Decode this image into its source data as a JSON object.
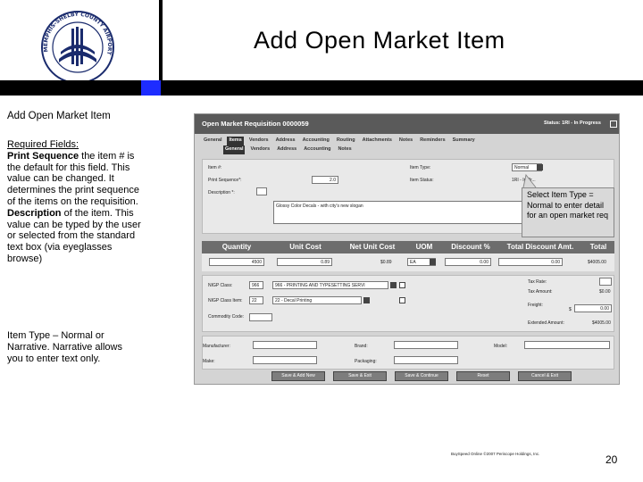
{
  "slide": {
    "title": "Add Open Market Item",
    "subtitle": "Add Open Market Item",
    "page_number": "20",
    "footer": "BuySpeed Online ©2007 Periscope Holdings, Inc."
  },
  "notes": {
    "required_heading": "Required Fields:",
    "print_sequence_term": "Print Sequence",
    "print_sequence_text": " the item # is the default for this field. This value can be changed. It determines the print sequence of the items on the requisition.",
    "description_term": "Description",
    "description_text": " of the item. This value can be typed by the user or selected from the standard text box (via eyeglasses browse)",
    "item_type_text": "Item Type – Normal or Narrative. Narrative allows you to enter text only."
  },
  "callout": {
    "text": "Select Item Type = Normal to enter detail for an open market req"
  },
  "app": {
    "title": "Open Market Requisition 0000059",
    "status": "Status: 1RI - In Progress",
    "tabs_main": [
      "General",
      "Items",
      "Vendors",
      "Address",
      "Accounting",
      "Routing",
      "Attachments",
      "Notes",
      "Reminders",
      "Summary"
    ],
    "tabs_sub": [
      "General",
      "Vendors",
      "Address",
      "Accounting",
      "Notes"
    ],
    "fields": {
      "item_no_label": "Item #:",
      "print_seq_label": "Print Sequence*:",
      "print_seq_value": "2.0",
      "description_label": "Description *:",
      "description_value": "Glossy Color Decals - with city's new slogan",
      "item_type_label": "Item Type:",
      "item_type_value": "Normal",
      "item_status_label": "Item Status:",
      "item_status_value": "1RI - In Pr..."
    },
    "grid": {
      "headers": [
        "Quantity",
        "Unit Cost",
        "Net Unit Cost",
        "UOM",
        "Discount %",
        "Total Discount Amt.",
        "Total"
      ],
      "row": {
        "quantity": "4500",
        "unit_cost": "0.89",
        "net_unit_cost": "$0.89",
        "uom": "EA",
        "discount": "0.00",
        "total_discount": "0.00",
        "total": "$4005.00"
      }
    },
    "nigp": {
      "class_label": "NIGP Class:",
      "class_value": "966",
      "class_desc": "966 - PRINTING AND TYPESETTING SERVI",
      "item_label": "NIGP Class Item:",
      "item_value": "22",
      "item_desc": "22 - Decal Printing",
      "commodity_label": "Commodity Code:",
      "tax_rate_label": "Tax Rate:",
      "tax_amount_label": "Tax Amount:",
      "tax_amount_value": "$0.00",
      "freight_label": "Freight:",
      "freight_value": "0.00",
      "freight_symbol": "$",
      "extended_label": "Extended Amount:",
      "extended_value": "$4005.00"
    },
    "extra": {
      "manufacturer_label": "Manufacturer:",
      "brand_label": "Brand:",
      "model_label": "Model:",
      "make_label": "Make:",
      "packaging_label": "Packaging:"
    },
    "buttons": [
      "Save & Add New",
      "Save & Exit",
      "Save & Continue",
      "Reset",
      "Cancel & Exit"
    ]
  },
  "colors": {
    "accent_blue": "#1d2cff",
    "header_dark": "#5a5a5a",
    "grid_header": "#6d6d6d"
  },
  "icons": [
    "airport-authority-logo",
    "printer-icon",
    "eyeglasses-browse-icon",
    "dropdown-arrow-icon"
  ]
}
